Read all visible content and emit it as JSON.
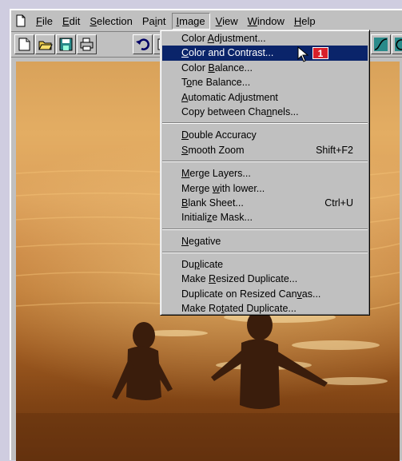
{
  "menubar": {
    "items": [
      {
        "pre": "",
        "key": "F",
        "post": "ile"
      },
      {
        "pre": "",
        "key": "E",
        "post": "dit"
      },
      {
        "pre": "",
        "key": "S",
        "post": "election"
      },
      {
        "pre": "Pa",
        "key": "i",
        "post": "nt"
      },
      {
        "pre": "",
        "key": "I",
        "post": "mage"
      },
      {
        "pre": "",
        "key": "V",
        "post": "iew"
      },
      {
        "pre": "",
        "key": "W",
        "post": "indow"
      },
      {
        "pre": "",
        "key": "H",
        "post": "elp"
      }
    ]
  },
  "toolbar": {
    "buttons": [
      "new-icon",
      "open-icon",
      "save-icon",
      "print-icon",
      "undo-icon",
      "page-icon",
      "curve-icon",
      "rotate-icon"
    ]
  },
  "image_menu": {
    "group1": [
      {
        "pre": "Color ",
        "key": "A",
        "post": "djustment..."
      },
      {
        "pre": "",
        "key": "C",
        "post": "olor and Contrast..."
      },
      {
        "pre": "Color ",
        "key": "B",
        "post": "alance..."
      },
      {
        "pre": "T",
        "key": "o",
        "post": "ne Balance..."
      },
      {
        "pre": "",
        "key": "A",
        "post": "utomatic Adjustment"
      },
      {
        "pre": "Copy between Cha",
        "key": "n",
        "post": "nels..."
      }
    ],
    "group2": [
      {
        "pre": "",
        "key": "D",
        "post": "ouble Accuracy",
        "shortcut": ""
      },
      {
        "pre": "",
        "key": "S",
        "post": "mooth Zoom",
        "shortcut": "Shift+F2"
      }
    ],
    "group3": [
      {
        "pre": "",
        "key": "M",
        "post": "erge Layers...",
        "shortcut": ""
      },
      {
        "pre": "Merge ",
        "key": "w",
        "post": "ith lower...",
        "shortcut": ""
      },
      {
        "pre": "",
        "key": "B",
        "post": "lank Sheet...",
        "shortcut": "Ctrl+U"
      },
      {
        "pre": "Initiali",
        "key": "z",
        "post": "e Mask...",
        "shortcut": ""
      }
    ],
    "group4": [
      {
        "pre": "",
        "key": "N",
        "post": "egative"
      }
    ],
    "group5": [
      {
        "pre": "Du",
        "key": "p",
        "post": "licate"
      },
      {
        "pre": "Make ",
        "key": "R",
        "post": "esized Duplicate..."
      },
      {
        "pre": "Duplicate on Resized Can",
        "key": "v",
        "post": "as..."
      },
      {
        "pre": "Make Ro",
        "key": "t",
        "post": "ated Duplicate..."
      }
    ],
    "badge": "1"
  },
  "colors": {
    "menu_highlight": "#0a246a",
    "badge": "#d8202a"
  }
}
